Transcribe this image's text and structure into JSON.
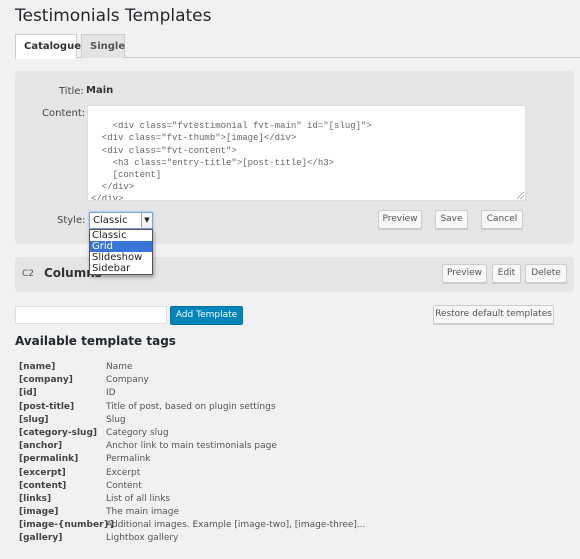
{
  "page": {
    "title": "Testimonials Templates"
  },
  "tabs": [
    {
      "label": "Catalogue",
      "active": true
    },
    {
      "label": "Single",
      "active": false
    }
  ],
  "editor": {
    "title_label": "Title:",
    "title_value": "Main",
    "content_label": "Content:",
    "content_value": "<div class=\"fvtestimonial fvt-main\" id=\"[slug]\">\n  <div class=\"fvt-thumb\">[image]</div>\n  <div class=\"fvt-content\">\n    <h3 class=\"entry-title\">[post-title]</h3>\n    [content]\n  </div>\n</div>",
    "style_label": "Style:",
    "style_selected": "Classic",
    "style_options": [
      "Classic",
      "Grid",
      "Slideshow",
      "Sidebar"
    ],
    "style_highlighted": "Grid",
    "preview_label": "Preview",
    "save_label": "Save",
    "cancel_label": "Cancel"
  },
  "template_item": {
    "id": "C2",
    "name": "Columns",
    "preview_label": "Preview",
    "edit_label": "Edit",
    "delete_label": "Delete"
  },
  "new_template": {
    "input_value": "",
    "add_label": "Add Template",
    "restore_label": "Restore default templates"
  },
  "tags_section": {
    "title": "Available template tags",
    "tags": [
      {
        "tag": "[name]",
        "desc": "Name"
      },
      {
        "tag": "[company]",
        "desc": "Company"
      },
      {
        "tag": "[id]",
        "desc": "ID"
      },
      {
        "tag": "[post-title]",
        "desc": "Title of post, based on plugin settings"
      },
      {
        "tag": "[slug]",
        "desc": "Slug"
      },
      {
        "tag": "[category-slug]",
        "desc": "Category slug"
      },
      {
        "tag": "[anchor]",
        "desc": "Anchor link to main testimonials page"
      },
      {
        "tag": "[permalink]",
        "desc": "Permalink"
      },
      {
        "tag": "[excerpt]",
        "desc": "Excerpt"
      },
      {
        "tag": "[content]",
        "desc": "Content"
      },
      {
        "tag": "[links]",
        "desc": "List of all links"
      },
      {
        "tag": "[image]",
        "desc": "The main image"
      },
      {
        "tag": "[image-{number}]",
        "desc": "Additional images. Example [image-two], [image-three]..."
      },
      {
        "tag": "[gallery]",
        "desc": "Lightbox gallery"
      }
    ]
  },
  "colors": {
    "primary_button": "#0085ba",
    "dropdown_highlight": "#3875d7"
  }
}
